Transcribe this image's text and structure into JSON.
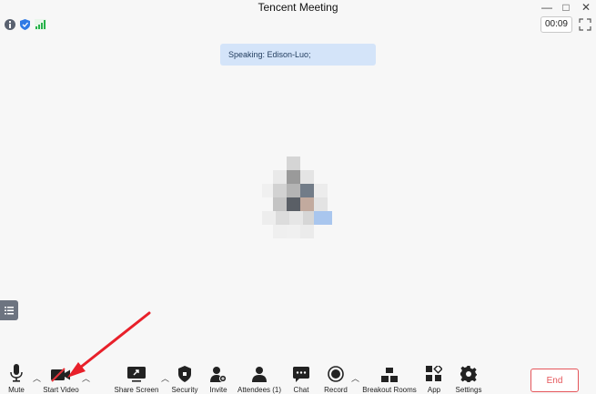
{
  "window": {
    "title": "Tencent Meeting",
    "minimize": "—",
    "maximize": "□",
    "close": "✕"
  },
  "infobar": {
    "timer": "00:09"
  },
  "speaking": {
    "text": "Speaking: Edison-Luo;"
  },
  "toolbar": {
    "mute": "Mute",
    "start_video": "Start Video",
    "share_screen": "Share Screen",
    "security": "Security",
    "invite": "Invite",
    "attendees": "Attendees (1)",
    "chat": "Chat",
    "record": "Record",
    "breakout_rooms": "Breakout Rooms",
    "app": "App",
    "settings": "Settings",
    "end": "End"
  },
  "colors": {
    "accent_end": "#e5555a",
    "speaking_bg": "#d4e4f9",
    "annotation_arrow": "#e8202a"
  }
}
